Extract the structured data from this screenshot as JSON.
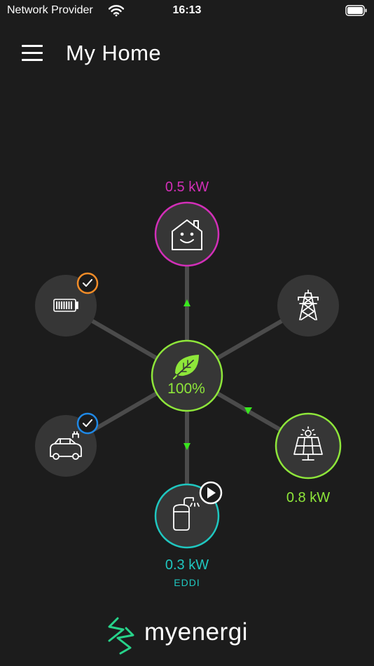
{
  "status_bar": {
    "carrier": "Network Provider",
    "time": "16:13"
  },
  "header": {
    "title": "My Home"
  },
  "flow": {
    "center": {
      "label": "100%",
      "icon": "leaf-icon",
      "color": "#8ee63a"
    },
    "home": {
      "power": "0.5 kW",
      "icon": "house-smiley-icon",
      "color": "#d22fb8"
    },
    "grid": {
      "icon": "pylon-icon"
    },
    "solar": {
      "power": "0.8 kW",
      "icon": "solar-panel-icon",
      "color": "#8ee63a"
    },
    "eddi": {
      "power": "0.3 kW",
      "name": "EDDI",
      "icon": "water-heater-icon",
      "color": "#1fc7c0"
    },
    "battery": {
      "icon": "battery-icon",
      "badge_color": "#f28c28"
    },
    "ev": {
      "icon": "ev-car-icon",
      "badge_color": "#1f88e5"
    }
  },
  "footer": {
    "logo_text": "myenergi",
    "accent": "#27d38a"
  }
}
